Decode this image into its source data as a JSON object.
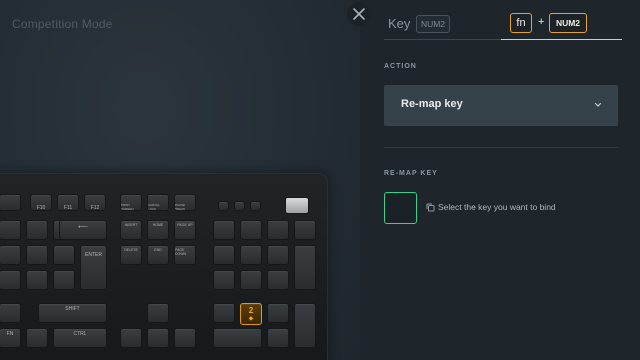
{
  "mode_title": "Competition Mode",
  "tabs": {
    "key_label": "Key",
    "key_chip": "NUM2",
    "fn_chip": "fn",
    "plus": "+",
    "combo_chip": "NUM2"
  },
  "action": {
    "section_title": "ACTION",
    "selected": "Re-map key"
  },
  "remap": {
    "section_title": "RE-MAP KEY",
    "hint": "Select the key you want to bind"
  },
  "keyboard": {
    "fkeys": [
      "F10",
      "F11",
      "F12"
    ],
    "nav_labels": [
      "PRINT SCREEN",
      "SCROLL LOCK",
      "PAUSE BREAK",
      "INSERT",
      "HOME",
      "PAGE UP",
      "DELETE",
      "END",
      "PAGE DOWN"
    ],
    "backspace": "⟵",
    "enter": "ENTER",
    "shift": "SHIFT",
    "ctrl": "CTRL",
    "fn": "FN",
    "highlighted_key": "2",
    "highlighted_sub": "⬥"
  },
  "colors": {
    "accent_orange": "#e8a321",
    "accent_green": "#3ccf8e",
    "panel_bg": "#1e262c",
    "dropdown_bg": "#36424a"
  },
  "icons": {
    "close": "close-icon",
    "chevron": "chevron-down-icon",
    "hint": "copy-icon"
  }
}
